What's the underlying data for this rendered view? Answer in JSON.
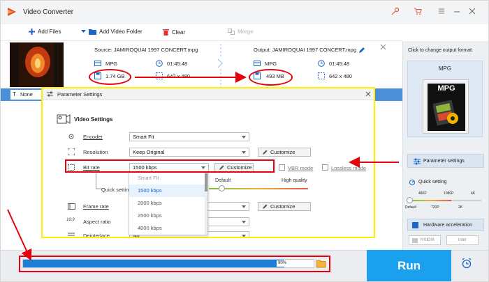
{
  "app": {
    "title": "Video Converter"
  },
  "toolbar": {
    "add_files": "Add Files",
    "add_video_folder": "Add Video Folder",
    "clear": "Clear",
    "merge": "Merge"
  },
  "file": {
    "source_label": "Source: JAMIROQUAI 1997 CONCERT.mpg",
    "output_label": "Output: JAMIROQUAI 1997 CONCERT.mpg",
    "source": {
      "format": "MPG",
      "duration": "01:45:48",
      "size": "1.74 GB",
      "resolution": "642 x 480"
    },
    "output": {
      "format": "MPG",
      "duration": "01:45:48",
      "size": "493 MB",
      "resolution": "642 x 480"
    }
  },
  "tabbar": {
    "none_label": "None"
  },
  "dialog": {
    "title": "Parameter Settings",
    "section_title": "Video Settings",
    "encoder": {
      "label": "Encoder",
      "value": "Smart Fit"
    },
    "resolution": {
      "label": "Resolution",
      "value": "Keep Original",
      "customize": "Customize"
    },
    "bitrate": {
      "label": "Bit rate",
      "value": "1500 kbps",
      "customize": "Customize"
    },
    "vbr_mode": "VBR mode",
    "lossless_mode": "Lossless mode",
    "quick_setting": {
      "label": "Quick setting",
      "default": "Default",
      "high": "High quality"
    },
    "framerate": {
      "label": "Frame rate",
      "customize": "Customize"
    },
    "aspect_ratio": {
      "label": "Aspect ratio"
    },
    "deinterlace": {
      "label": "Deinterlace",
      "value": "No"
    },
    "dropdown_options": [
      "Smart Fit",
      "1500 kbps",
      "2000 kbps",
      "2500 kbps",
      "4000 kbps"
    ],
    "dropdown_selected_index": 1
  },
  "right_panel": {
    "hint": "Click to change output format:",
    "format_name": "MPG",
    "format_badge": "MPG",
    "parameter_settings": "Parameter settings",
    "quick_setting": "Quick setting",
    "scale_top": [
      "480P",
      "1080P",
      "4K"
    ],
    "scale_bottom": [
      "Default",
      "720P",
      "2K"
    ],
    "hardware_acceleration": "Hardware acceleration",
    "nvidia": "NVIDIA",
    "intel": "Intel"
  },
  "progress": {
    "percent_label": "90%",
    "fraction": 0.9
  },
  "run": {
    "label": "Run"
  },
  "colors": {
    "accent": "#1aa0ec",
    "annotation": "#e8000b",
    "highlight": "#ffee00"
  },
  "icons": [
    "app-logo-icon",
    "key-icon",
    "cart-icon",
    "menu-icon",
    "minimize-icon",
    "close-icon",
    "plus-icon",
    "folder-icon",
    "trash-icon",
    "merge-icon",
    "edit-icon",
    "film-icon",
    "clock-icon",
    "disk-icon",
    "resize-icon",
    "alarm-icon"
  ]
}
